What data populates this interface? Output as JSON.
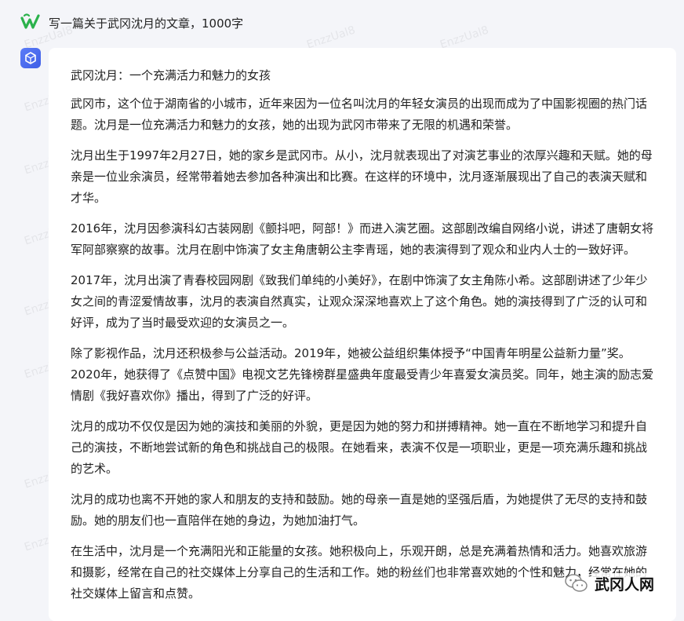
{
  "user_prompt": "写一篇关于武冈沈月的文章，1000字",
  "answer": {
    "title": "武冈沈月：一个充满活力和魅力的女孩",
    "paragraphs": [
      "武冈市，这个位于湖南省的小城市，近年来因为一位名叫沈月的年轻女演员的出现而成为了中国影视圈的热门话题。沈月是一位充满活力和魅力的女孩，她的出现为武冈市带来了无限的机遇和荣誉。",
      "沈月出生于1997年2月27日，她的家乡是武冈市。从小，沈月就表现出了对演艺事业的浓厚兴趣和天赋。她的母亲是一位业余演员，经常带着她去参加各种演出和比赛。在这样的环境中，沈月逐渐展现出了自己的表演天赋和才华。",
      "2016年，沈月因参演科幻古装网剧《颤抖吧，阿部！》而进入演艺圈。这部剧改编自网络小说，讲述了唐朝女将军阿部察察的故事。沈月在剧中饰演了女主角唐朝公主李青瑶，她的表演得到了观众和业内人士的一致好评。",
      "2017年，沈月出演了青春校园网剧《致我们单纯的小美好》，在剧中饰演了女主角陈小希。这部剧讲述了少年少女之间的青涩爱情故事，沈月的表演自然真实，让观众深深地喜欢上了这个角色。她的演技得到了广泛的认可和好评，成为了当时最受欢迎的女演员之一。",
      "除了影视作品，沈月还积极参与公益活动。2019年，她被公益组织集体授予“中国青年明星公益新力量”奖。2020年，她获得了《点赞中国》电视文艺先锋榜群星盛典年度最受青少年喜爱女演员奖。同年，她主演的励志爱情剧《我好喜欢你》播出，得到了广泛的好评。",
      "沈月的成功不仅仅是因为她的演技和美丽的外貌，更是因为她的努力和拼搏精神。她一直在不断地学习和提升自己的演技，不断地尝试新的角色和挑战自己的极限。在她看来，表演不仅是一项职业，更是一项充满乐趣和挑战的艺术。",
      "沈月的成功也离不开她的家人和朋友的支持和鼓励。她的母亲一直是她的坚强后盾，为她提供了无尽的支持和鼓励。她的朋友们也一直陪伴在她的身边，为她加油打气。",
      "在生活中，沈月是一个充满阳光和正能量的女孩。她积极向上，乐观开朗，总是充满着热情和活力。她喜欢旅游和摄影，经常在自己的社交媒体上分享自己的生活和工作。她的粉丝们也非常喜欢她的个性和魅力，经常在她的社交媒体上留言和点赞。"
    ]
  },
  "watermark_text": "EnzzUal8",
  "brand": "武冈人网",
  "colors": {
    "background": "#f4f5f9",
    "card": "#ffffff",
    "bot_avatar": "#4a6cf0",
    "user_logo": "#2bb24c"
  },
  "icons": {
    "user_avatar": "wave-logo-icon",
    "bot_avatar": "cube-icon",
    "brand": "wechat-icon"
  }
}
